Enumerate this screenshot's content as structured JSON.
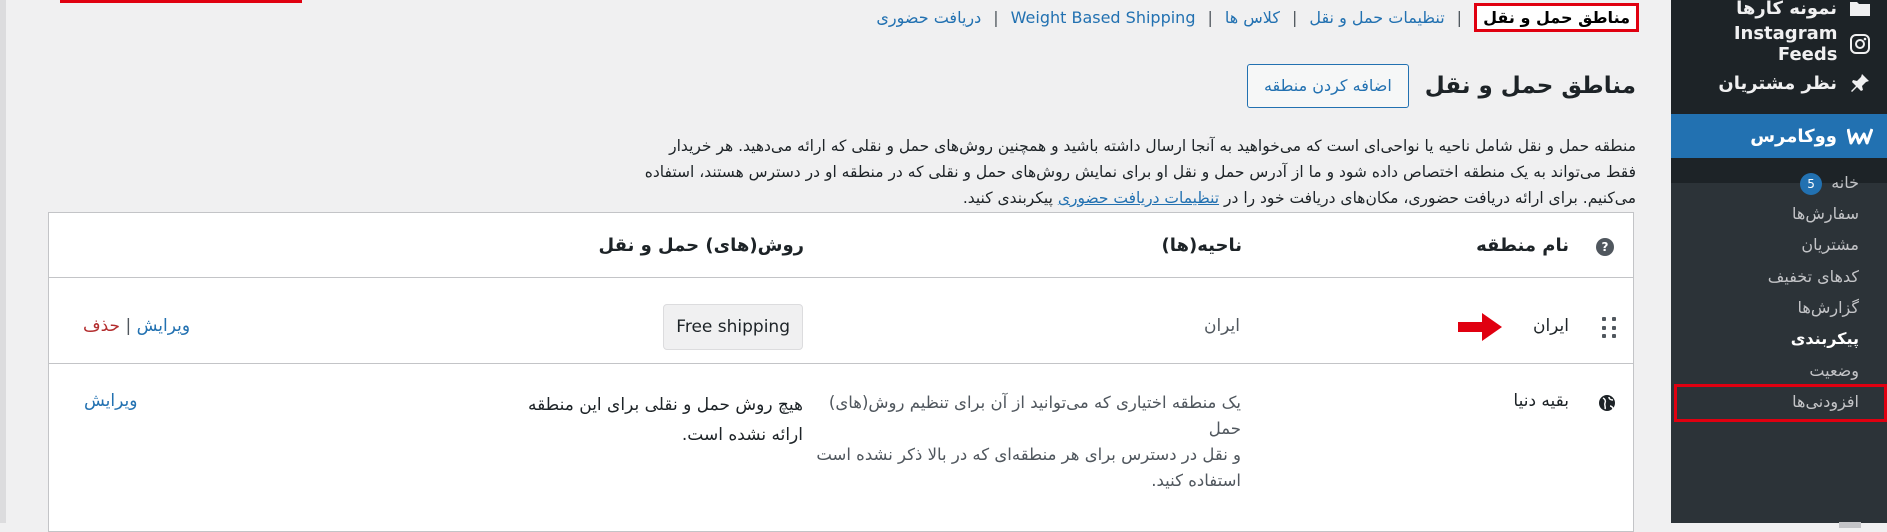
{
  "sidebar": {
    "items_top": [
      {
        "label": "نمونه کارها",
        "icon": "folder-icon"
      },
      {
        "label": "Instagram Feeds",
        "icon": "instagram-icon"
      },
      {
        "label": "نظر مشتریان",
        "icon": "pin-icon"
      },
      {
        "label": "ووکامرس",
        "icon": "woocommerce-icon"
      }
    ],
    "submenu": [
      {
        "label": "خانه",
        "badge": "5"
      },
      {
        "label": "سفارش‌ها"
      },
      {
        "label": "مشتریان"
      },
      {
        "label": "کدهای تخفیف"
      },
      {
        "label": "گزارش‌ها"
      },
      {
        "label": "پیکربندی"
      },
      {
        "label": "وضعیت"
      },
      {
        "label": "افزودنی‌ها"
      }
    ]
  },
  "subnav": {
    "current": "مناطق حمل و نقل",
    "links": [
      "تنظیمات حمل و نقل",
      "کلاس ها",
      "Weight Based Shipping",
      "دریافت حضوری"
    ],
    "separator": "|"
  },
  "page": {
    "title": "مناطق حمل و نقل",
    "add_button": "اضافه کردن منطقه",
    "description_1": "منطقه حمل و نقل شامل ناحیه یا نواحی‌ای است که می‌خواهید به آنجا ارسال داشته باشید و همچنین روش‌های حمل و نقلی که ارائه می‌دهید. هر خریدار",
    "description_2": "فقط می‌تواند به یک منطقه اختصاص داده شود و ما از آدرس حمل و نقل او برای نمایش روش‌های حمل و نقلی که در منطقه او در دسترس هستند، استفاده",
    "description_3a": "می‌کنیم. برای ارائه دریافت حضوری، مکان‌های دریافت خود را در",
    "description_link": "تنظیمات دریافت حضوری",
    "description_3b": "پیکربندی کنید."
  },
  "table": {
    "headers": {
      "zone_name": "نام منطقه",
      "regions": "ناحیه(ها)",
      "methods": "روش(های) حمل و نقل"
    },
    "help_icon": "?",
    "rows": [
      {
        "name": "ایران",
        "region": "ایران",
        "method": "Free shipping",
        "edit": "ویرایش",
        "separator": "|",
        "delete": "حذف"
      },
      {
        "name": "بقیه دنیا",
        "region_line1": "یک منطقه اختیاری که می‌توانید از آن برای تنظیم روش(های) حمل",
        "region_line2": "و نقل در دسترس برای هر منطقه‌ای که در بالا ذکر نشده است",
        "region_line3": "استفاده کنید.",
        "method_line1": "هیچ روش حمل و نقلی برای این منطقه",
        "method_line2": "ارائه نشده است.",
        "edit": "ویرایش"
      }
    ]
  },
  "colors": {
    "accent": "#2271b1",
    "highlight": "#e00010",
    "sidebar": "#1d2327",
    "arrow": "#e00010"
  }
}
